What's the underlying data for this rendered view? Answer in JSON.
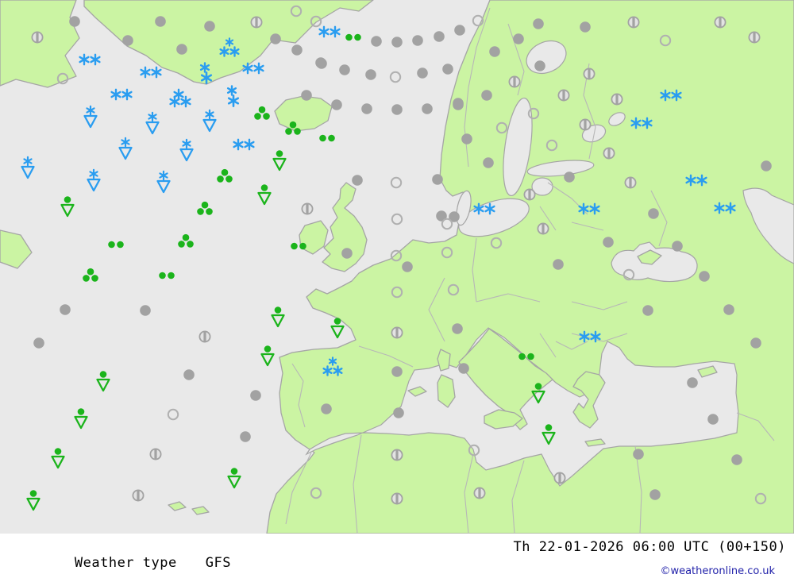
{
  "footer": {
    "product_label": "Weather type",
    "model_label": "GFS",
    "valid_time_label": "Th 22-01-2026 06:00 UTC (00+150)",
    "copyright_label": "©weatheronline.co.uk"
  },
  "colors": {
    "sea": "#e9e9e9",
    "land": "#cbf4a3",
    "coast": "#a5a5a5",
    "border": "#b7b7b7",
    "snow": "#2a9df0",
    "rain": "#1bb41b",
    "cloud": "#a2a2a2",
    "cloud_open": "#b0b0b0",
    "partly_fill": "#e3e3e3",
    "footer_bg": "#ffffff",
    "footer_text": "#000000",
    "copyright_text": "#2222aa"
  },
  "chart_data": {
    "type": "weather-symbol-map",
    "region": "Europe / North Atlantic",
    "legend": {
      "oc": "overcast - grey filled circle",
      "pc": "partly cloudy - grey circle with vertical bar",
      "cl": "clear - grey open circle",
      "s2": "continuous snow - two blue snowflakes",
      "s1": "light snow - one blue snowflake",
      "s3": "heavy snow - three blue snowflakes",
      "sc": "snow flurries - stacked blue snowflakes",
      "ss": "snow shower - blue snowflake over open triangle",
      "rs": "rain shower - green dot over open triangle",
      "r2": "light rain - two green dots",
      "r3": "moderate rain - three green dots"
    },
    "symbols": [
      [
        "oc",
        94,
        27
      ],
      [
        "oc",
        161,
        51
      ],
      [
        "oc",
        202,
        27
      ],
      [
        "oc",
        264,
        33
      ],
      [
        "oc",
        229,
        62
      ],
      [
        "oc",
        347,
        49
      ],
      [
        "oc",
        374,
        63
      ],
      [
        "oc",
        405,
        80
      ],
      [
        "oc",
        474,
        52
      ],
      [
        "oc",
        500,
        53
      ],
      [
        "oc",
        526,
        51
      ],
      [
        "oc",
        553,
        46
      ],
      [
        "oc",
        579,
        38
      ],
      [
        "oc",
        404,
        79
      ],
      [
        "oc",
        434,
        88
      ],
      [
        "oc",
        467,
        94
      ],
      [
        "oc",
        532,
        92
      ],
      [
        "oc",
        564,
        87
      ],
      [
        "oc",
        386,
        120
      ],
      [
        "oc",
        424,
        132
      ],
      [
        "oc",
        462,
        137
      ],
      [
        "oc",
        500,
        138
      ],
      [
        "oc",
        538,
        137
      ],
      [
        "oc",
        577,
        130
      ],
      [
        "oc",
        623,
        65
      ],
      [
        "oc",
        678,
        30
      ],
      [
        "oc",
        737,
        34
      ],
      [
        "oc",
        653,
        49
      ],
      [
        "oc",
        613,
        120
      ],
      [
        "oc",
        680,
        83
      ],
      [
        "oc",
        577,
        132
      ],
      [
        "oc",
        588,
        175
      ],
      [
        "oc",
        615,
        205
      ],
      [
        "oc",
        717,
        223
      ],
      [
        "oc",
        823,
        269
      ],
      [
        "oc",
        766,
        305
      ],
      [
        "oc",
        703,
        333
      ],
      [
        "oc",
        853,
        310
      ],
      [
        "oc",
        965,
        209
      ],
      [
        "oc",
        887,
        348
      ],
      [
        "oc",
        450,
        227
      ],
      [
        "oc",
        551,
        226
      ],
      [
        "oc",
        556,
        272
      ],
      [
        "oc",
        572,
        273
      ],
      [
        "oc",
        437,
        319
      ],
      [
        "oc",
        513,
        336
      ],
      [
        "oc",
        82,
        390
      ],
      [
        "oc",
        183,
        391
      ],
      [
        "oc",
        49,
        432
      ],
      [
        "oc",
        238,
        472
      ],
      [
        "oc",
        309,
        550
      ],
      [
        "oc",
        500,
        468
      ],
      [
        "oc",
        322,
        498
      ],
      [
        "oc",
        411,
        515
      ],
      [
        "oc",
        502,
        520
      ],
      [
        "oc",
        576,
        414
      ],
      [
        "oc",
        584,
        464
      ],
      [
        "oc",
        816,
        391
      ],
      [
        "oc",
        918,
        390
      ],
      [
        "oc",
        952,
        432
      ],
      [
        "oc",
        872,
        482
      ],
      [
        "oc",
        898,
        528
      ],
      [
        "oc",
        804,
        572
      ],
      [
        "oc",
        928,
        579
      ],
      [
        "oc",
        825,
        623
      ],
      [
        "pc",
        47,
        47
      ],
      [
        "pc",
        323,
        28
      ],
      [
        "pc",
        798,
        28
      ],
      [
        "pc",
        907,
        28
      ],
      [
        "pc",
        950,
        47
      ],
      [
        "pc",
        648,
        103
      ],
      [
        "pc",
        742,
        93
      ],
      [
        "pc",
        710,
        120
      ],
      [
        "pc",
        777,
        125
      ],
      [
        "pc",
        737,
        157
      ],
      [
        "pc",
        767,
        193
      ],
      [
        "pc",
        794,
        230
      ],
      [
        "pc",
        667,
        245
      ],
      [
        "pc",
        684,
        288
      ],
      [
        "pc",
        387,
        263
      ],
      [
        "pc",
        258,
        424
      ],
      [
        "pc",
        500,
        419
      ],
      [
        "pc",
        196,
        572
      ],
      [
        "pc",
        174,
        624
      ],
      [
        "pc",
        500,
        573
      ],
      [
        "pc",
        500,
        628
      ],
      [
        "pc",
        604,
        621
      ],
      [
        "pc",
        705,
        602
      ],
      [
        "cl",
        373,
        14
      ],
      [
        "cl",
        398,
        27
      ],
      [
        "cl",
        602,
        26
      ],
      [
        "cl",
        838,
        51
      ],
      [
        "cl",
        79,
        99
      ],
      [
        "cl",
        672,
        143
      ],
      [
        "cl",
        632,
        161
      ],
      [
        "cl",
        695,
        183
      ],
      [
        "cl",
        498,
        97
      ],
      [
        "cl",
        499,
        230
      ],
      [
        "cl",
        500,
        276
      ],
      [
        "cl",
        563,
        282
      ],
      [
        "cl",
        499,
        322
      ],
      [
        "cl",
        563,
        318
      ],
      [
        "cl",
        500,
        368
      ],
      [
        "cl",
        571,
        365
      ],
      [
        "cl",
        625,
        306
      ],
      [
        "cl",
        792,
        346
      ],
      [
        "cl",
        218,
        522
      ],
      [
        "cl",
        597,
        567
      ],
      [
        "cl",
        398,
        621
      ],
      [
        "cl",
        958,
        628
      ],
      [
        "s2",
        113,
        75
      ],
      [
        "s2",
        153,
        119
      ],
      [
        "s2",
        190,
        91
      ],
      [
        "s2",
        227,
        128
      ],
      [
        "s2",
        307,
        182
      ],
      [
        "s2",
        319,
        86
      ],
      [
        "s2",
        415,
        40
      ],
      [
        "s2",
        610,
        263
      ],
      [
        "s2",
        742,
        263
      ],
      [
        "s2",
        845,
        120
      ],
      [
        "s2",
        808,
        155
      ],
      [
        "s2",
        877,
        227
      ],
      [
        "s2",
        913,
        262
      ],
      [
        "s2",
        743,
        424
      ],
      [
        "s1",
        225,
        119
      ],
      [
        "s3",
        289,
        62
      ],
      [
        "s3",
        419,
        464
      ],
      [
        "sc",
        258,
        92
      ],
      [
        "sc",
        292,
        121
      ],
      [
        "ss",
        35,
        212
      ],
      [
        "ss",
        114,
        148
      ],
      [
        "ss",
        118,
        228
      ],
      [
        "ss",
        158,
        188
      ],
      [
        "ss",
        192,
        156
      ],
      [
        "ss",
        206,
        230
      ],
      [
        "ss",
        235,
        190
      ],
      [
        "ss",
        264,
        153
      ],
      [
        "rs",
        85,
        260
      ],
      [
        "rs",
        130,
        480
      ],
      [
        "rs",
        102,
        527
      ],
      [
        "rs",
        73,
        577
      ],
      [
        "rs",
        42,
        630
      ],
      [
        "rs",
        295,
        602
      ],
      [
        "rs",
        350,
        399
      ],
      [
        "rs",
        425,
        413
      ],
      [
        "rs",
        337,
        448
      ],
      [
        "rs",
        333,
        245
      ],
      [
        "rs",
        352,
        202
      ],
      [
        "rs",
        691,
        547
      ],
      [
        "rs",
        678,
        495
      ],
      [
        "r2",
        445,
        47
      ],
      [
        "r2",
        412,
        174
      ],
      [
        "r2",
        376,
        310
      ],
      [
        "r2",
        146,
        308
      ],
      [
        "r2",
        210,
        347
      ],
      [
        "r2",
        663,
        449
      ],
      [
        "r3",
        330,
        143
      ],
      [
        "r3",
        369,
        162
      ],
      [
        "r3",
        283,
        222
      ],
      [
        "r3",
        258,
        263
      ],
      [
        "r3",
        234,
        304
      ],
      [
        "r3",
        114,
        347
      ]
    ]
  }
}
